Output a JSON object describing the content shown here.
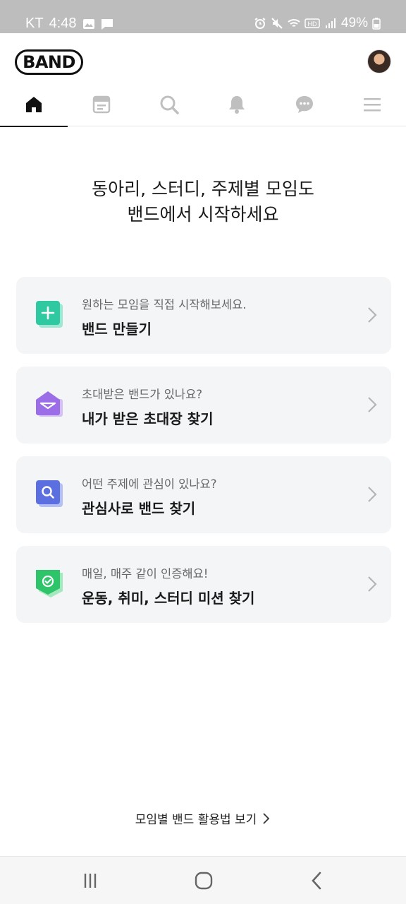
{
  "status_bar": {
    "carrier": "KT",
    "time": "4:48",
    "battery": "49%"
  },
  "header": {
    "logo_text": "BAND"
  },
  "tabs": [
    {
      "name": "home-icon",
      "active": true
    },
    {
      "name": "feed-icon",
      "active": false
    },
    {
      "name": "search-icon",
      "active": false
    },
    {
      "name": "bell-icon",
      "active": false
    },
    {
      "name": "chat-icon",
      "active": false
    },
    {
      "name": "menu-icon",
      "active": false
    }
  ],
  "headline": {
    "line1": "동아리, 스터디, 주제별 모임도",
    "line2": "밴드에서 시작하세요"
  },
  "cards": [
    {
      "subtitle": "원하는 모임을 직접 시작해보세요.",
      "title": "밴드 만들기",
      "icon": "plus-icon",
      "color": "#2ec9a0"
    },
    {
      "subtitle": "초대받은 밴드가 있나요?",
      "title": "내가 받은 초대장 찾기",
      "icon": "envelope-icon",
      "color": "#9b6ee8"
    },
    {
      "subtitle": "어떤 주제에 관심이 있나요?",
      "title": "관심사로 밴드 찾기",
      "icon": "search-icon",
      "color": "#5b6fe0"
    },
    {
      "subtitle": "매일, 매주 같이 인증해요!",
      "title": "운동, 취미, 스터디 미션 찾기",
      "icon": "check-shield-icon",
      "color": "#2ec46a"
    }
  ],
  "footer": {
    "guide_link": "모임별 밴드 활용법 보기"
  }
}
